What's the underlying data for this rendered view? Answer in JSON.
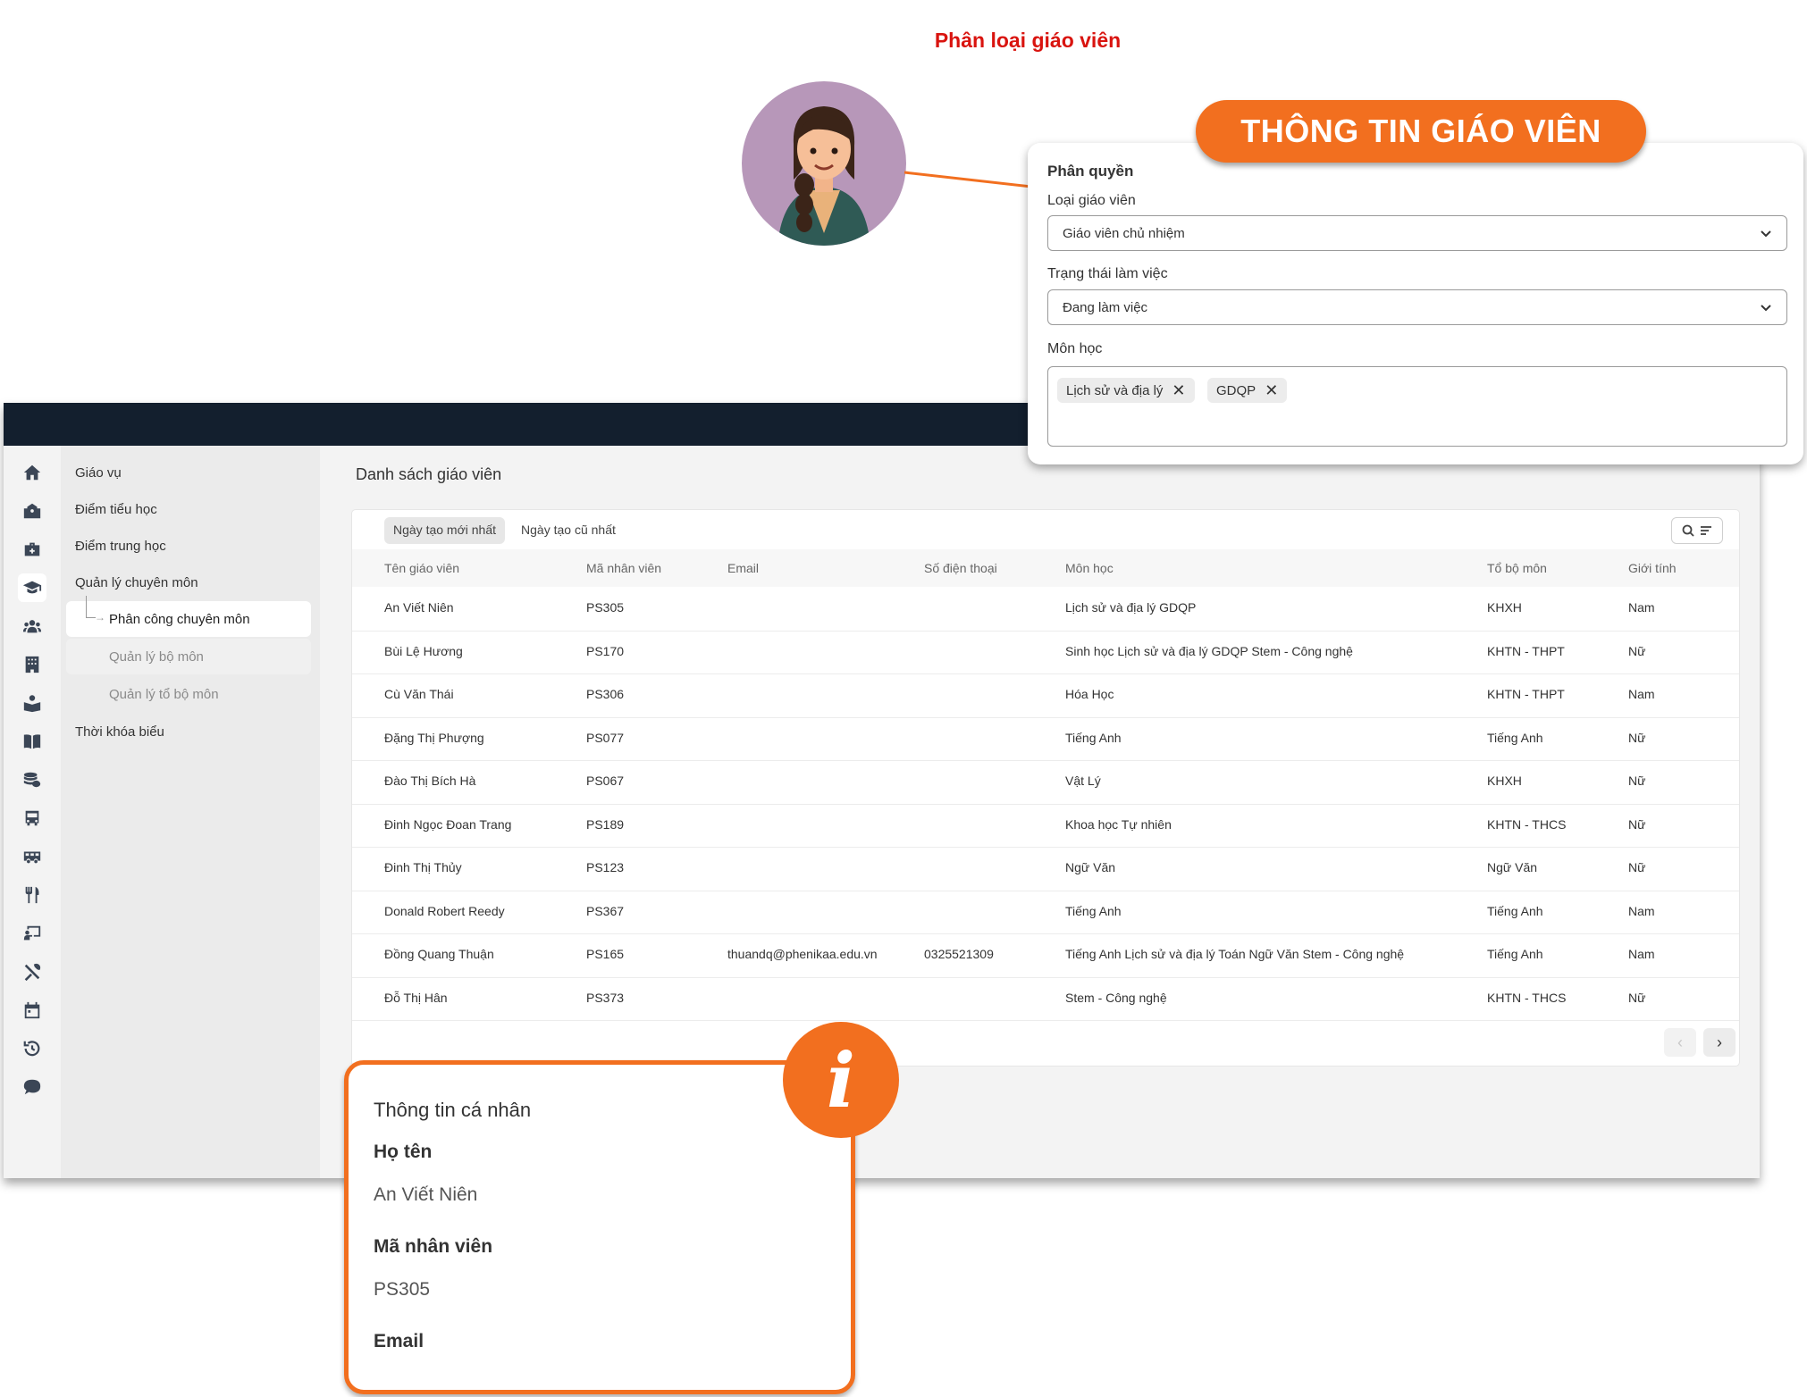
{
  "hero_title": "Phân loại giáo viên",
  "teacher_info_badge": "THÔNG TIN GIÁO VIÊN",
  "colors": {
    "accent": "#f26f1f",
    "title_red": "#d9140f",
    "topbar": "#131f2e"
  },
  "permissions_panel": {
    "section": "Phân quyền",
    "teacher_type_label": "Loại giáo viên",
    "teacher_type_value": "Giáo viên chủ nhiệm",
    "work_status_label": "Trạng thái làm việc",
    "work_status_value": "Đang làm việc",
    "subject_label": "Môn học",
    "subject_tags": [
      "Lịch sử và địa lý",
      "GDQP"
    ],
    "tag_remove_glyph": "✕"
  },
  "rail_icons": [
    "home-icon",
    "school-icon",
    "briefcase-icon",
    "graduation-cap-icon",
    "users-icon",
    "building-icon",
    "reader-icon",
    "book-icon",
    "coins-icon",
    "bus-icon",
    "van-icon",
    "utensils-icon",
    "chalkboard-icon",
    "tools-icon",
    "calendar-icon",
    "history-icon",
    "chat-icon"
  ],
  "sidebar": {
    "items": [
      "Giáo vụ",
      "Điểm tiểu học",
      "Điểm trung học",
      "Quản lý chuyên môn"
    ],
    "subitems": [
      "Phân công chuyên môn",
      "Quản lý bộ môn",
      "Quản lý tổ bộ môn"
    ],
    "branch_arrow": "→",
    "last_item": "Thời khóa biểu"
  },
  "content_title": "Danh sách giáo viên",
  "sort_tabs": [
    "Ngày tạo mới nhất",
    "Ngày tạo cũ nhất"
  ],
  "table": {
    "headers": [
      "Tên giáo viên",
      "Mã nhân viên",
      "Email",
      "Số điện thoại",
      "Môn học",
      "Tổ bộ môn",
      "Giới tính"
    ],
    "rows": [
      [
        "An Viết Niên",
        "PS305",
        "",
        "",
        "Lịch sử và địa lý  GDQP",
        "KHXH",
        "Nam"
      ],
      [
        "Bùi Lệ Hương",
        "PS170",
        "",
        "",
        "Sinh học  Lịch sử và địa lý  GDQP  Stem - Công nghệ",
        "KHTN - THPT",
        "Nữ"
      ],
      [
        "Cù Văn Thái",
        "PS306",
        "",
        "",
        "Hóa Học",
        "KHTN - THPT",
        "Nam"
      ],
      [
        "Đặng Thị Phượng",
        "PS077",
        "",
        "",
        "Tiếng Anh",
        "Tiếng Anh",
        "Nữ"
      ],
      [
        "Đào Thị Bích Hà",
        "PS067",
        "",
        "",
        "Vật Lý",
        "KHXH",
        "Nữ"
      ],
      [
        "Đinh Ngọc Đoan Trang",
        "PS189",
        "",
        "",
        "Khoa học Tự nhiên",
        "KHTN - THCS",
        "Nữ"
      ],
      [
        "Đinh Thị Thủy",
        "PS123",
        "",
        "",
        "Ngữ Văn",
        "Ngữ Văn",
        "Nữ"
      ],
      [
        "Donald Robert Reedy",
        "PS367",
        "",
        "",
        "Tiếng Anh",
        "Tiếng Anh",
        "Nam"
      ],
      [
        "Đồng Quang Thuận",
        "PS165",
        "thuandq@phenikaa.edu.vn",
        "0325521309",
        "Tiếng Anh  Lịch sử và địa lý  Toán  Ngữ Văn  Stem - Công nghệ",
        "Tiếng Anh",
        "Nam"
      ],
      [
        "Đỗ Thị Hân",
        "PS373",
        "",
        "",
        "Stem - Công nghệ",
        "KHTN - THCS",
        "Nữ"
      ]
    ]
  },
  "pager": {
    "prev": "‹",
    "next": "›"
  },
  "personal_card": {
    "title": "Thông tin cá nhân",
    "name_label": "Họ tên",
    "name_value": "An Viết Niên",
    "code_label": "Mã nhân viên",
    "code_value": "PS305",
    "email_label": "Email"
  },
  "info_glyph": "i"
}
